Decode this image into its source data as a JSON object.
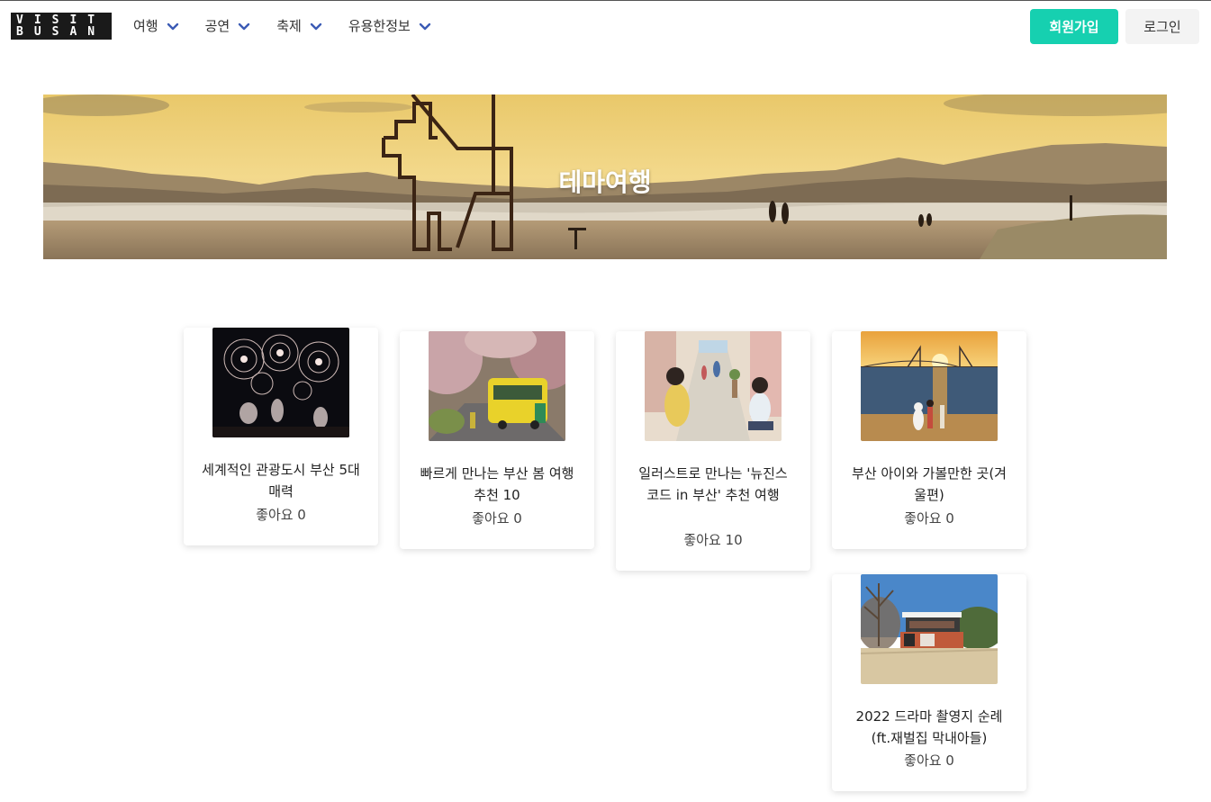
{
  "nav": {
    "logo_line1": "VISIT",
    "logo_line2": "BUSAN",
    "menu": [
      "여행",
      "공연",
      "축제",
      "유용한정보"
    ],
    "signup": "회원가입",
    "login": "로그인",
    "accent": "#16d0b0",
    "chevron_color": "#3b5bb5"
  },
  "hero": {
    "title": "테마여행"
  },
  "cards": [
    {
      "title": "세계적인 관광도시 부산 5대 매력",
      "likes": "좋아요 0",
      "image": "fireworks-photo"
    },
    {
      "title": "빠르게 만나는 부산 봄 여행 추천 10",
      "likes": "좋아요 0",
      "image": "spring-train-photo"
    },
    {
      "title": "일러스트로 만나는 '뉴진스 코드 in 부산' 추천 여행",
      "likes": "좋아요 10",
      "image": "illustration-street"
    },
    {
      "title": "부산 아이와 가볼만한 곳(겨울편)",
      "likes": "좋아요 0",
      "image": "sunset-bridge-photo"
    },
    {
      "title": "2022 드라마 촬영지 순례(ft.재벌집 막내아들)",
      "likes": "좋아요 0",
      "image": "house-photo"
    }
  ]
}
